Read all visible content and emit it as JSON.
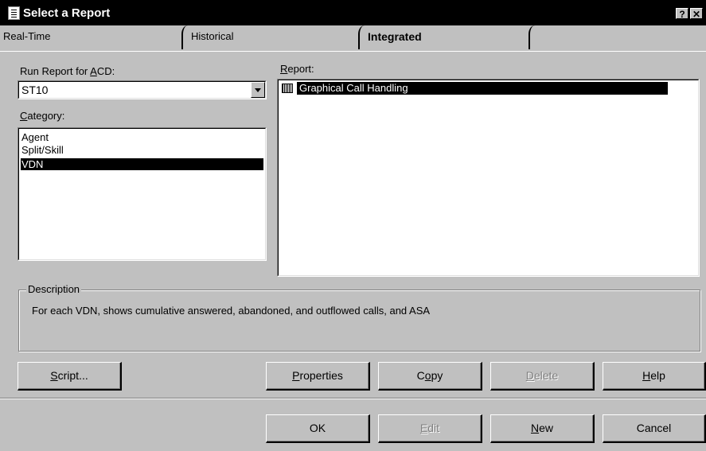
{
  "window": {
    "title": "Select a Report",
    "help_glyph": "?",
    "close_glyph": "✕"
  },
  "tabs": [
    {
      "label": "Real-Time",
      "selected": false
    },
    {
      "label": "Historical",
      "selected": false
    },
    {
      "label": "Integrated",
      "selected": true
    }
  ],
  "acd": {
    "label_pre": "Run Report for ",
    "label_key": "A",
    "label_post": "CD:",
    "value": "ST10"
  },
  "category": {
    "label_key": "C",
    "label_post": "ategory:",
    "items": [
      "Agent",
      "Split/Skill",
      "VDN"
    ],
    "selected": "VDN"
  },
  "report": {
    "label_key": "R",
    "label_post": "eport:",
    "items": [
      "Graphical Call Handling"
    ],
    "selected": "Graphical Call Handling"
  },
  "description": {
    "label": "Description",
    "text": "For each VDN, shows cumulative answered, abandoned, and outflowed calls, and ASA"
  },
  "buttons_row1": {
    "script": {
      "key": "S",
      "rest": "cript...",
      "enabled": true
    },
    "properties": {
      "key": "P",
      "rest": "roperties",
      "enabled": true
    },
    "copy": {
      "pre": "C",
      "key": "o",
      "rest": "py",
      "enabled": true
    },
    "delete": {
      "key": "D",
      "rest": "elete",
      "enabled": false
    },
    "help": {
      "key": "H",
      "rest": "elp",
      "enabled": true
    }
  },
  "buttons_row2": {
    "ok": {
      "label": "OK",
      "enabled": true
    },
    "edit": {
      "key": "E",
      "rest": "dit",
      "enabled": false
    },
    "new": {
      "key": "N",
      "rest": "ew",
      "enabled": true
    },
    "cancel": {
      "label": "Cancel",
      "enabled": true
    }
  },
  "colors": {
    "face": "#c0c0c0",
    "titlebar": "#000000",
    "selection": "#000000",
    "disabled_text": "#808080"
  }
}
